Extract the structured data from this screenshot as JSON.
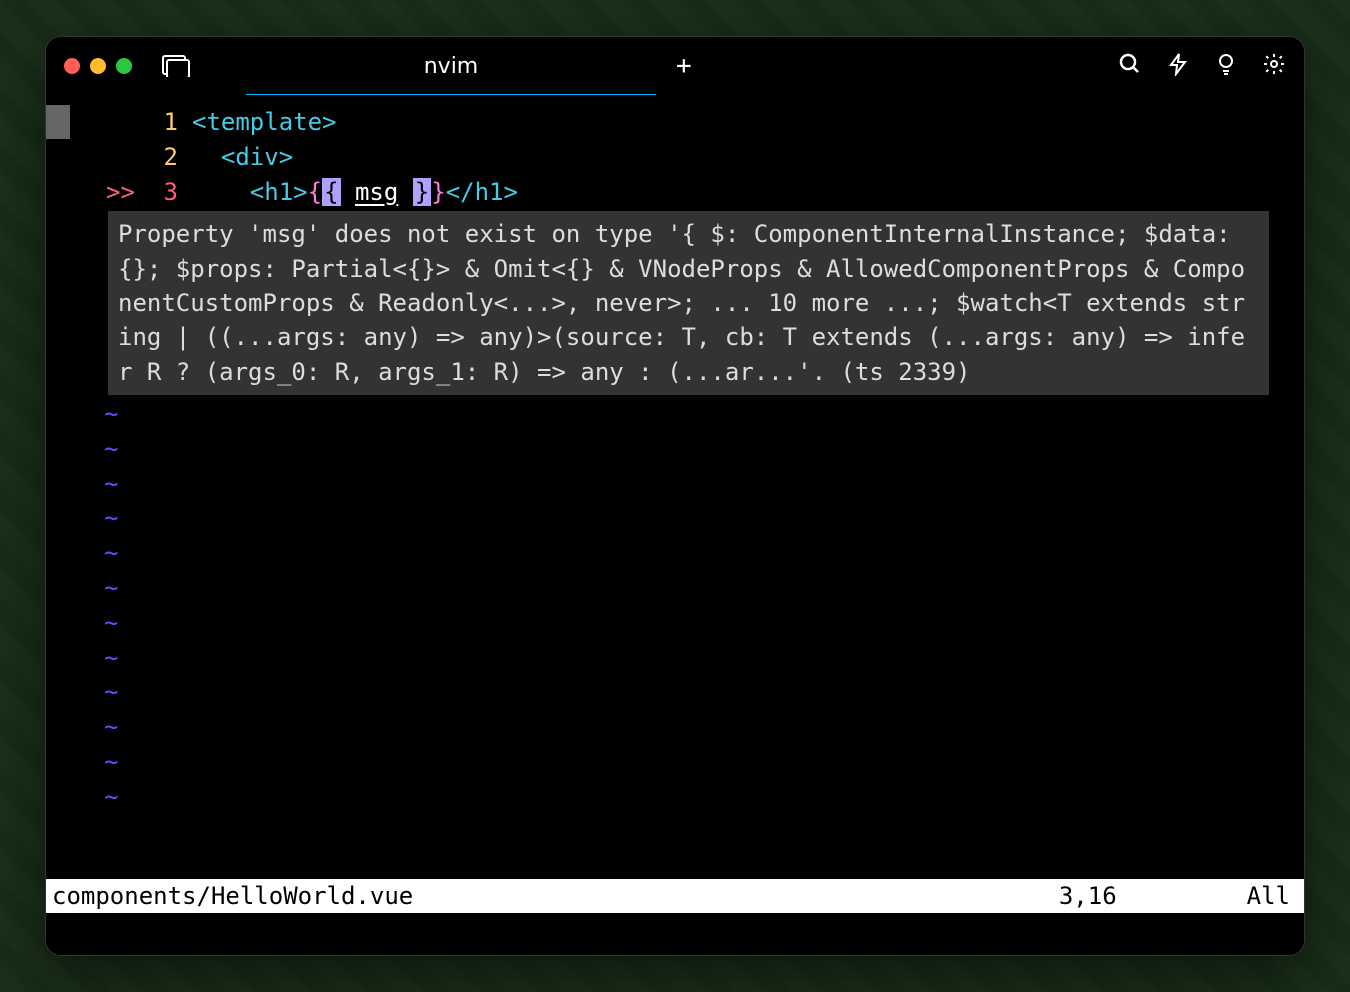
{
  "window": {
    "tab_title": "nvim"
  },
  "editor": {
    "lines": [
      {
        "num": "1",
        "indicator": "",
        "content": "<template>"
      },
      {
        "num": "2",
        "indicator": "",
        "content": "  <div>"
      },
      {
        "num": "3",
        "indicator": ">>",
        "content": "    <h1>{{ msg }}</h1>"
      }
    ],
    "line3_parts": {
      "prefix": "    ",
      "h1_open": "<h1>",
      "brace_open": "{",
      "brace_hl_open": "{",
      "space1": " ",
      "msg": "msg",
      "space2": " ",
      "brace_hl_close": "}",
      "brace_close": "}",
      "h1_close": "</h1>"
    },
    "diagnostic": "Property 'msg' does not exist on type '{ $: ComponentInternalInstance; $data: {}; $props: Partial<{}> & Omit<{} & VNodeProps & AllowedComponentProps & ComponentCustomProps & Readonly<...>, never>; ... 10 more ...; $watch<T extends string | ((...args: any) => any)>(source: T, cb: T extends (...args: any) => infer R ? (args_0: R, args_1: R) => any : (...ar...'. (ts 2339)",
    "empty_indicator": "~"
  },
  "statusbar": {
    "file": "components/HelloWorld.vue",
    "position": "3,16",
    "percent": "All"
  }
}
